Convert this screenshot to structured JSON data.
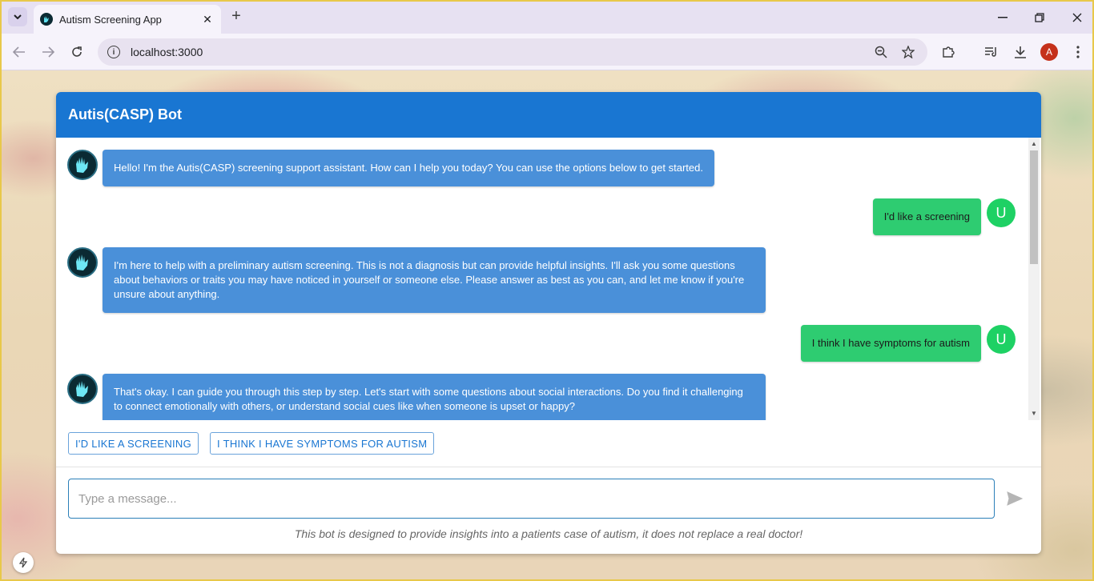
{
  "browser": {
    "tab_title": "Autism Screening App",
    "url": "localhost:3000",
    "profile_initial": "A",
    "new_tab_symbol": "+",
    "tab_close_symbol": "✕"
  },
  "chat": {
    "header_title": "Autis(CASP) Bot",
    "messages": [
      {
        "sender": "bot",
        "text": "Hello! I'm the Autis(CASP) screening support assistant. How can I help you today? You can use the options below to get started."
      },
      {
        "sender": "user",
        "text": "I'd like a screening",
        "avatar": "U"
      },
      {
        "sender": "bot",
        "text": "I'm here to help with a preliminary autism screening. This is not a diagnosis but can provide helpful insights. I'll ask you some questions about behaviors or traits you may have noticed in yourself or someone else. Please answer as best as you can, and let me know if you're unsure about anything."
      },
      {
        "sender": "user",
        "text": "I think I have symptoms for autism",
        "avatar": "U"
      },
      {
        "sender": "bot",
        "text": "That's okay. I can guide you through this step by step. Let's start with some questions about social interactions. Do you find it challenging to connect emotionally with others, or understand social cues like when someone is upset or happy?"
      }
    ],
    "quick_replies": [
      "I'D LIKE A SCREENING",
      "I THINK I HAVE SYMPTOMS FOR AUTISM"
    ],
    "input_placeholder": "Type a message...",
    "disclaimer": "This bot is designed to provide insights into a patients case of autism, it does not replace a real doctor!"
  },
  "colors": {
    "header": "#1976d2",
    "bot_bubble": "#4a90d9",
    "user_bubble": "#2ecc71",
    "user_avatar": "#1ed164"
  }
}
